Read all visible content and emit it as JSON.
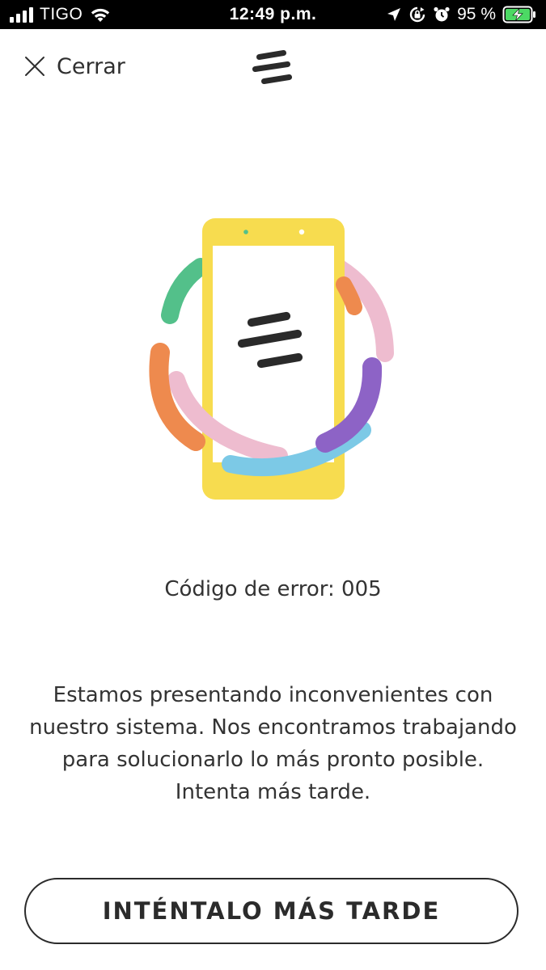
{
  "status_bar": {
    "carrier": "TIGO",
    "time": "12:49 p.m.",
    "battery_percent": "95 %",
    "icons": [
      "signal-icon",
      "wifi-icon",
      "location-arrow-icon",
      "rotation-lock-icon",
      "alarm-icon",
      "battery-charging-icon"
    ]
  },
  "header": {
    "close_label": "Cerrar",
    "logo": "brand-logo-icon"
  },
  "illustration": {
    "name": "phone-error-illustration",
    "colors": {
      "phone": "#F7DC4F",
      "green": "#53C08A",
      "orange": "#EE8A4E",
      "pink": "#EEBCCF",
      "purple": "#8D63C6",
      "blue": "#7CC9E6",
      "logo": "#2A2A2A"
    }
  },
  "error": {
    "code_text": "Código de error: 005"
  },
  "message": {
    "lines": [
      "Estamos presentando inconvenientes con",
      "nuestro sistema. Nos encontramos trabajando",
      "para solucionarlo lo más pronto posible.",
      "Intenta más tarde."
    ]
  },
  "button": {
    "label": "INTÉNTALO MÁS TARDE"
  }
}
